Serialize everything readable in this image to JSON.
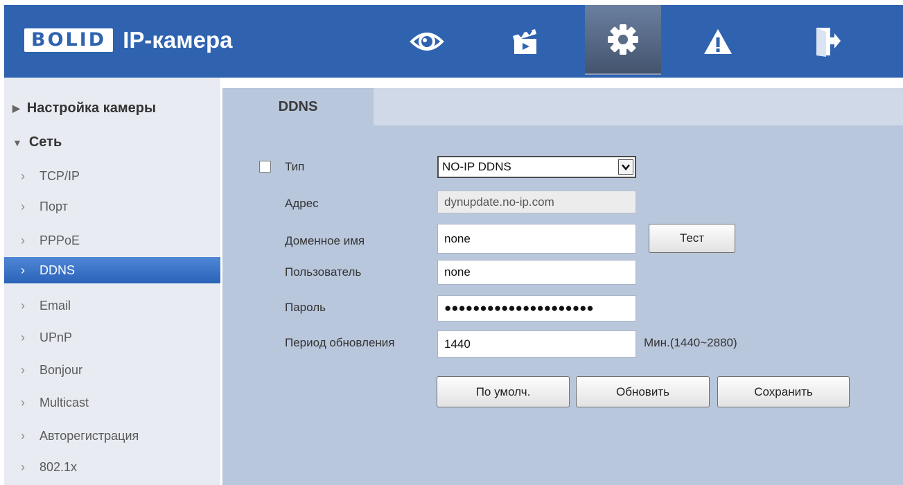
{
  "header": {
    "brand": "BOLID",
    "product": "IP-камера",
    "nav": [
      {
        "name": "live-view",
        "icon": "eye-icon"
      },
      {
        "name": "playback",
        "icon": "clapperboard-icon"
      },
      {
        "name": "setup",
        "icon": "gear-icon",
        "active": true
      },
      {
        "name": "alarm",
        "icon": "warning-icon"
      },
      {
        "name": "logout",
        "icon": "exit-door-icon"
      }
    ]
  },
  "sidebar": {
    "camera_settings": "Настройка камеры",
    "network": "Сеть",
    "items": [
      "TCP/IP",
      "Порт",
      "PPPoE",
      "DDNS",
      "Email",
      "UPnP",
      "Bonjour",
      "Multicast",
      "Авторегистрация",
      "802.1x"
    ],
    "active_item": "DDNS"
  },
  "tab": {
    "label": "DDNS"
  },
  "form": {
    "type_label": "Тип",
    "type_checked": false,
    "type_value": "NO-IP DDNS",
    "address_label": "Адрес",
    "address_value": "dynupdate.no-ip.com",
    "domain_label": "Доменное имя",
    "domain_value": "none",
    "test_button": "Тест",
    "user_label": "Пользователь",
    "user_value": "none",
    "password_label": "Пароль",
    "password_value": "●●●●●●●●●●●●●●●●●●●●●",
    "period_label": "Период обновления",
    "period_value": "1440",
    "period_hint": "Мин.(1440~2880)"
  },
  "buttons": {
    "default": "По умолч.",
    "refresh": "Обновить",
    "save": "Сохранить"
  },
  "colors": {
    "header": "#2f63b0",
    "panel": "#b9c7dc",
    "sidebar_active": "#2a63b8"
  }
}
